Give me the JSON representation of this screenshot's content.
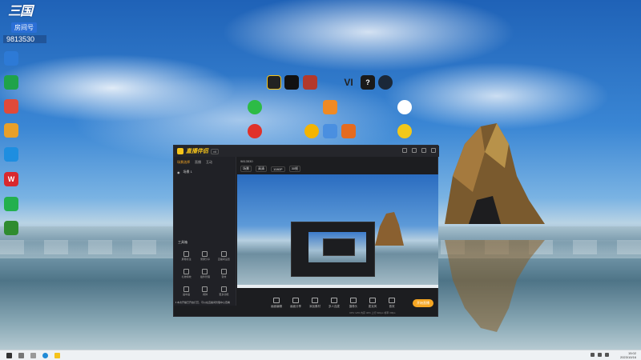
{
  "badge": {
    "logo": "三国",
    "tag": "房间号",
    "room_number": "9813530"
  },
  "desktop_icons": [
    {
      "name": "app-icon-1",
      "label": "",
      "color": "#2d7ad6"
    },
    {
      "name": "app-icon-2",
      "label": "",
      "color": "#1fa34a"
    },
    {
      "name": "app-icon-3",
      "label": "",
      "color": "#e04a3a"
    },
    {
      "name": "app-icon-4",
      "label": "",
      "color": "#e8a02a"
    },
    {
      "name": "app-icon-5",
      "label": "",
      "color": "#1e8ee0"
    },
    {
      "name": "wps-icon",
      "label": "",
      "color": "#d9282e"
    },
    {
      "name": "app-icon-7",
      "label": "",
      "color": "#23b04e"
    },
    {
      "name": "nvidia-icon",
      "label": "",
      "color": "#2f8c2f"
    }
  ],
  "app": {
    "name": "直播伴侣",
    "version": "v6",
    "tabs": [
      "场景选择",
      "直播",
      "互动"
    ],
    "scene_label": "场景 1",
    "tools_title": "工具箱",
    "tools": [
      "屏幕标注",
      "录屏分享",
      "直播间设置",
      "礼物特效",
      "插件管理",
      "音效",
      "画中画",
      "闹钟",
      "更多功能"
    ],
    "notice": "ℹ 本次开播已开启打赏，可以在直播间管理中心查看",
    "toolbar_title": "9813530",
    "toolbar_chips": [
      "场景",
      "高清",
      "1080P",
      "30帧"
    ],
    "bottom_tools": [
      "画面编辑",
      "画面分享",
      "添加素材",
      "多人连麦",
      "摄像头",
      "麦克风",
      "音效"
    ],
    "start_label": "开始直播",
    "status": "CPU 12%  内存 46%  上行 0kbps  帧率 30fps"
  },
  "taskbar": {
    "time": "15:02",
    "date": "2023/10/16"
  }
}
